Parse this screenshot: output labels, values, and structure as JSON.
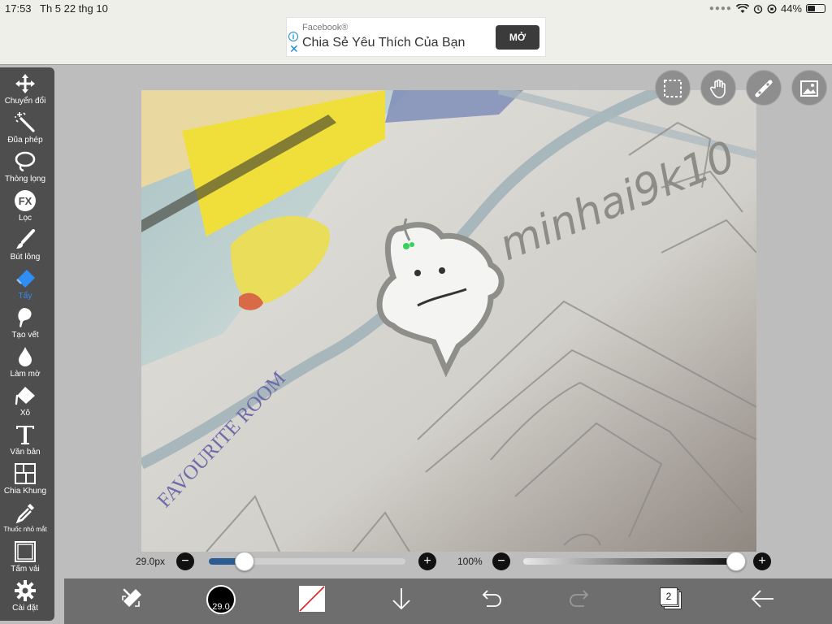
{
  "status_bar": {
    "time": "17:53",
    "date": "Th 5 22 thg 10",
    "battery": "44%",
    "battery_level": 0.44
  },
  "ad": {
    "source": "Facebook®",
    "title": "Chia Sẻ Yêu Thích Của Bạn",
    "cta": "MỞ"
  },
  "tools": [
    {
      "label": "Chuyển đổi",
      "icon": "move-icon"
    },
    {
      "label": "Đũa phép",
      "icon": "magic-wand-icon"
    },
    {
      "label": "Thòng lọng",
      "icon": "lasso-icon"
    },
    {
      "label": "Lọc",
      "icon": "fx-filter-icon"
    },
    {
      "label": "Bút lông",
      "icon": "brush-icon"
    },
    {
      "label": "Tẩy",
      "icon": "eraser-icon",
      "active": true
    },
    {
      "label": "Tạo vết",
      "icon": "smudge-icon"
    },
    {
      "label": "Làm mờ",
      "icon": "blur-drop-icon"
    },
    {
      "label": "Xô",
      "icon": "bucket-icon"
    },
    {
      "label": "Văn bản",
      "icon": "text-icon"
    },
    {
      "label": "Chia Khung",
      "icon": "frame-divider-icon"
    },
    {
      "label": "Thuốc nhỏ mắt",
      "icon": "eyedropper-icon"
    },
    {
      "label": "Tấm vải",
      "icon": "canvas-icon"
    },
    {
      "label": "Cài đặt",
      "icon": "gear-icon"
    }
  ],
  "canvas": {
    "watermark": "minhai9k10",
    "book_text": "FAVOURITE ROOM"
  },
  "brush_size": {
    "value": "29.0px",
    "level": 0.18
  },
  "opacity": {
    "value": "100%",
    "level": 1.0
  },
  "bottom_bar": {
    "brush_indicator": "29.0",
    "layer_count": "2"
  },
  "colors": {
    "accent": "#2f8df5",
    "toolbar_bg": "#4e4e4e",
    "bottom_bar_bg": "#6e6e6e",
    "ad_button": "#3b3b3b"
  }
}
